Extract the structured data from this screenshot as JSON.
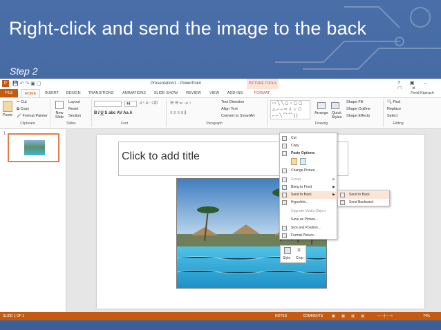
{
  "slide": {
    "heading": "Right-click and send the image to the back",
    "step": "Step 2"
  },
  "titlebar": {
    "title": "Presentation1 - PowerPoint",
    "context_tab": "PICTURE TOOLS",
    "user": "Ferid Kipirach"
  },
  "tabs": [
    "FILE",
    "HOME",
    "INSERT",
    "DESIGN",
    "TRANSITIONS",
    "ANIMATIONS",
    "SLIDE SHOW",
    "REVIEW",
    "VIEW",
    "ADD-INS",
    "FORMAT"
  ],
  "ribbon": {
    "paste": "Paste",
    "cut": "Cut",
    "copy": "Copy",
    "format_painter": "Format Painter",
    "new_slide": "New Slide",
    "layout": "Layout",
    "reset": "Reset",
    "section": "Section",
    "font_size": "44",
    "text_direction": "Text Direction",
    "align_text": "Align Text",
    "convert_smartart": "Convert to SmartArt",
    "arrange": "Arrange",
    "quick_styles": "Quick Styles",
    "shape_fill": "Shape Fill",
    "shape_outline": "Shape Outline",
    "shape_effects": "Shape Effects",
    "find": "Find",
    "replace": "Replace",
    "select": "Select",
    "groups": {
      "clipboard": "Clipboard",
      "slides": "Slides",
      "font": "Font",
      "paragraph": "Paragraph",
      "drawing": "Drawing",
      "editing": "Editing"
    }
  },
  "thumb": {
    "number": "1"
  },
  "canvas": {
    "title_placeholder": "Click to add title"
  },
  "context_menu": {
    "items": [
      {
        "label": "Cut",
        "disabled": false
      },
      {
        "label": "Copy",
        "disabled": false
      },
      {
        "label": "Paste Options:",
        "disabled": false
      },
      {
        "label": "Change Picture...",
        "disabled": false
      },
      {
        "label": "Group",
        "disabled": true
      },
      {
        "label": "Bring to Front",
        "disabled": false
      },
      {
        "label": "Send to Back",
        "disabled": false
      },
      {
        "label": "Hyperlink...",
        "disabled": false
      },
      {
        "label": "Upgrade Media Object",
        "disabled": true
      },
      {
        "label": "Save as Picture...",
        "disabled": false
      },
      {
        "label": "Size and Position...",
        "disabled": false
      },
      {
        "label": "Format Picture...",
        "disabled": false
      }
    ],
    "highlighted": "Send to Back"
  },
  "submenu": {
    "send_to_back": "Send to Back",
    "send_backward": "Send Backward"
  },
  "mini_toolbar": {
    "style": "Style",
    "crop": "Crop"
  },
  "status": {
    "slide_of": "SLIDE 1 OF 1",
    "notes": "NOTES",
    "comments": "COMMENTS",
    "zoom": "74%"
  },
  "colors": {
    "accent": "#c55a11",
    "slide_bg": "#3b5f97",
    "context_tab": "#c0504d"
  }
}
